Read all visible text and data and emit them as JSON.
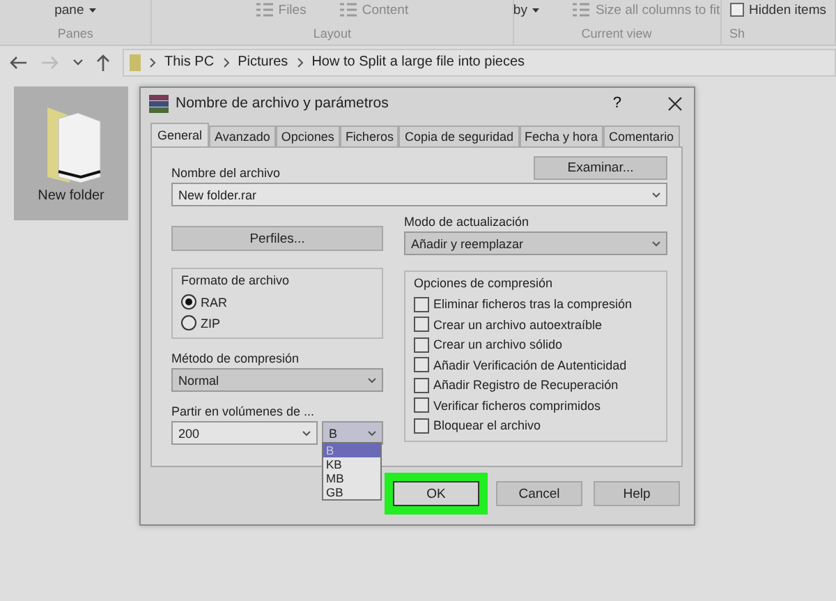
{
  "ribbon": {
    "groups": [
      {
        "label": "Panes",
        "items": [
          {
            "text": "pane",
            "kind": "dropdown"
          }
        ]
      },
      {
        "label": "Layout",
        "items": [
          {
            "text": "Files",
            "kind": "icon"
          },
          {
            "text": "Content",
            "kind": "icon"
          }
        ]
      },
      {
        "label": "Current view",
        "items": [
          {
            "text": "by",
            "kind": "dropdown"
          },
          {
            "text": "Size all columns to fit",
            "kind": "icon"
          }
        ]
      },
      {
        "label": "Sh",
        "items": [
          {
            "text": "Hidden items",
            "kind": "checkbox",
            "checked": false
          }
        ]
      }
    ]
  },
  "address": {
    "crumbs": [
      "This PC",
      "Pictures",
      "How to Split a large file into pieces"
    ]
  },
  "files": [
    {
      "name": "New folder",
      "selected": true
    }
  ],
  "dialog": {
    "title": "Nombre de archivo y parámetros",
    "help": "?",
    "tabs": [
      {
        "label": "General",
        "selected": true
      },
      {
        "label": "Avanzado",
        "selected": false
      },
      {
        "label": "Opciones",
        "selected": false
      },
      {
        "label": "Ficheros",
        "selected": false
      },
      {
        "label": "Copia de seguridad",
        "selected": false
      },
      {
        "label": "Fecha y hora",
        "selected": false
      },
      {
        "label": "Comentario",
        "selected": false
      }
    ],
    "archive_name_label": "Nombre del archivo",
    "archive_name": "New folder.rar",
    "browse_button": "Examinar...",
    "profiles_button": "Perfiles...",
    "update_mode": {
      "label": "Modo de actualización",
      "value": "Añadir y reemplazar"
    },
    "format": {
      "label": "Formato de archivo",
      "options": [
        {
          "label": "RAR",
          "selected": true
        },
        {
          "label": "ZIP",
          "selected": false
        }
      ]
    },
    "method": {
      "label": "Método de compresión",
      "value": "Normal"
    },
    "split": {
      "label": "Partir en volúmenes de ...",
      "value": "200",
      "unit": "B",
      "unit_options": [
        {
          "label": "B",
          "selected": true
        },
        {
          "label": "KB",
          "selected": false
        },
        {
          "label": "MB",
          "selected": false
        },
        {
          "label": "GB",
          "selected": false
        }
      ]
    },
    "options": {
      "label": "Opciones de compresión",
      "items": [
        {
          "label": "Eliminar ficheros tras la compresión",
          "checked": false
        },
        {
          "label": "Crear un archivo autoextraíble",
          "checked": false
        },
        {
          "label": "Crear un archivo sólido",
          "checked": false
        },
        {
          "label": "Añadir Verificación de Autenticidad",
          "checked": false
        },
        {
          "label": "Añadir Registro de Recuperación",
          "checked": false
        },
        {
          "label": "Verificar ficheros comprimidos",
          "checked": false
        },
        {
          "label": "Bloquear el archivo",
          "checked": false
        }
      ]
    },
    "buttons": [
      {
        "label": "OK",
        "highlighted": true
      },
      {
        "label": "Cancel",
        "highlighted": false
      },
      {
        "label": "Help",
        "highlighted": false
      }
    ]
  }
}
